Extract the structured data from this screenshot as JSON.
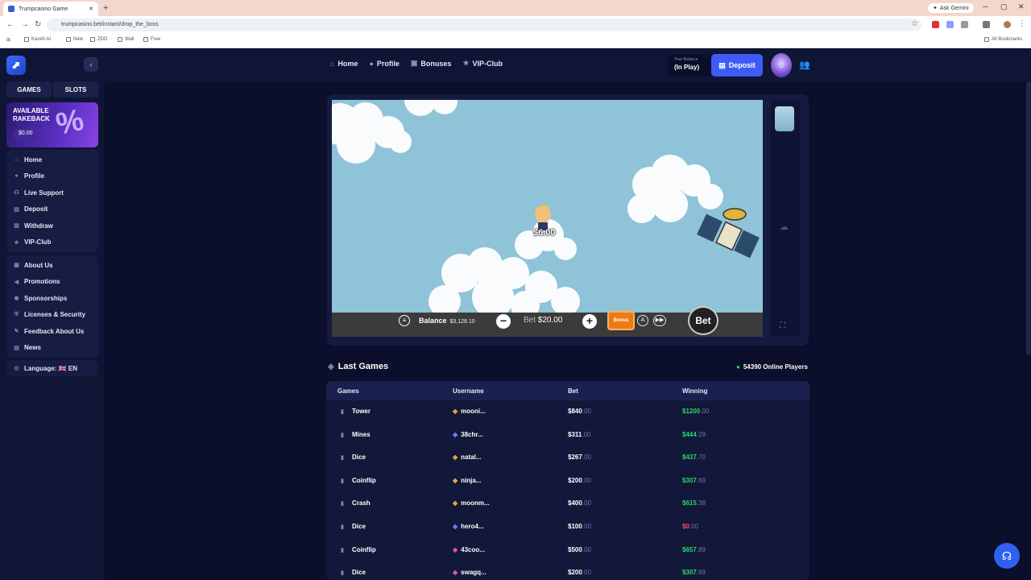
{
  "browser": {
    "tab_title": "Trumpcasino Game",
    "url": "trumpcasino.bet/instant/drop_the_boss",
    "gemini_label": "Ask Gemini",
    "bookmarks": [
      "Kaveh AI",
      "New",
      "ZDD",
      "Wall",
      "Free"
    ],
    "all_bookmarks": "All Bookmarks"
  },
  "header": {
    "nav": [
      {
        "label": "Home",
        "icon": "home-icon"
      },
      {
        "label": "Profile",
        "icon": "profile-icon"
      },
      {
        "label": "Bonuses",
        "icon": "gift-icon"
      },
      {
        "label": "VIP-Club",
        "icon": "star-icon"
      }
    ],
    "balance_label": "Your Balance",
    "balance_value": "(In Play)",
    "deposit_label": "Deposit"
  },
  "sidebar": {
    "tabs": [
      "GAMES",
      "SLOTS"
    ],
    "rakeback": {
      "title_line1": "AVAILABLE",
      "title_line2": "RAKEBACK",
      "amount": "$0.00"
    },
    "group1": [
      "Home",
      "Profile",
      "Live Support",
      "Deposit",
      "Withdraw",
      "VIP-Club"
    ],
    "group2": [
      "About Us",
      "Promotions",
      "Sponsorships",
      "Licenses & Security",
      "Feedback About Us",
      "News"
    ],
    "language": "Language: 🇬🇧 EN"
  },
  "game": {
    "multiplier": "$6.00",
    "balance_label": "Balance",
    "balance_value": "$3,128.10",
    "bet_label": "Bet",
    "bet_value": "$20.00",
    "bonus_label": "Bonus",
    "bet_button": "Bet"
  },
  "last_games": {
    "title": "Last Games",
    "online": "54390 Online Players",
    "headers": [
      "Games",
      "Username",
      "Bet",
      "Winning"
    ],
    "rows": [
      {
        "game": "Tower",
        "user": "mooni...",
        "bet_int": "$840",
        "bet_dec": ".00",
        "win_int": "$1200",
        "win_dec": ".00",
        "win_color": "#2bd66b"
      },
      {
        "game": "Mines",
        "user": "38chr...",
        "bet_int": "$311",
        "bet_dec": ".00",
        "win_int": "$444",
        "win_dec": ".29",
        "win_color": "#2bd66b"
      },
      {
        "game": "Dice",
        "user": "natal...",
        "bet_int": "$267",
        "bet_dec": ".00",
        "win_int": "$437",
        "win_dec": ".70",
        "win_color": "#2bd66b"
      },
      {
        "game": "Coinflip",
        "user": "ninja...",
        "bet_int": "$200",
        "bet_dec": ".00",
        "win_int": "$307",
        "win_dec": ".69",
        "win_color": "#2bd66b"
      },
      {
        "game": "Crash",
        "user": "moonm...",
        "bet_int": "$400",
        "bet_dec": ".00",
        "win_int": "$615",
        "win_dec": ".38",
        "win_color": "#2bd66b"
      },
      {
        "game": "Dice",
        "user": "hero4...",
        "bet_int": "$100",
        "bet_dec": ".00",
        "win_int": "$0",
        "win_dec": ".00",
        "win_color": "#ff4d6d"
      },
      {
        "game": "Coinflip",
        "user": "43coo...",
        "bet_int": "$500",
        "bet_dec": ".00",
        "win_int": "$657",
        "win_dec": ".89",
        "win_color": "#2bd66b"
      },
      {
        "game": "Dice",
        "user": "swagq...",
        "bet_int": "$200",
        "bet_dec": ".00",
        "win_int": "$307",
        "win_dec": ".69",
        "win_color": "#2bd66b"
      }
    ]
  },
  "colors": {
    "accent": "#3e5cf5",
    "win": "#2bd66b",
    "loss": "#ff4d6d",
    "bonus": "#ef7a14"
  }
}
